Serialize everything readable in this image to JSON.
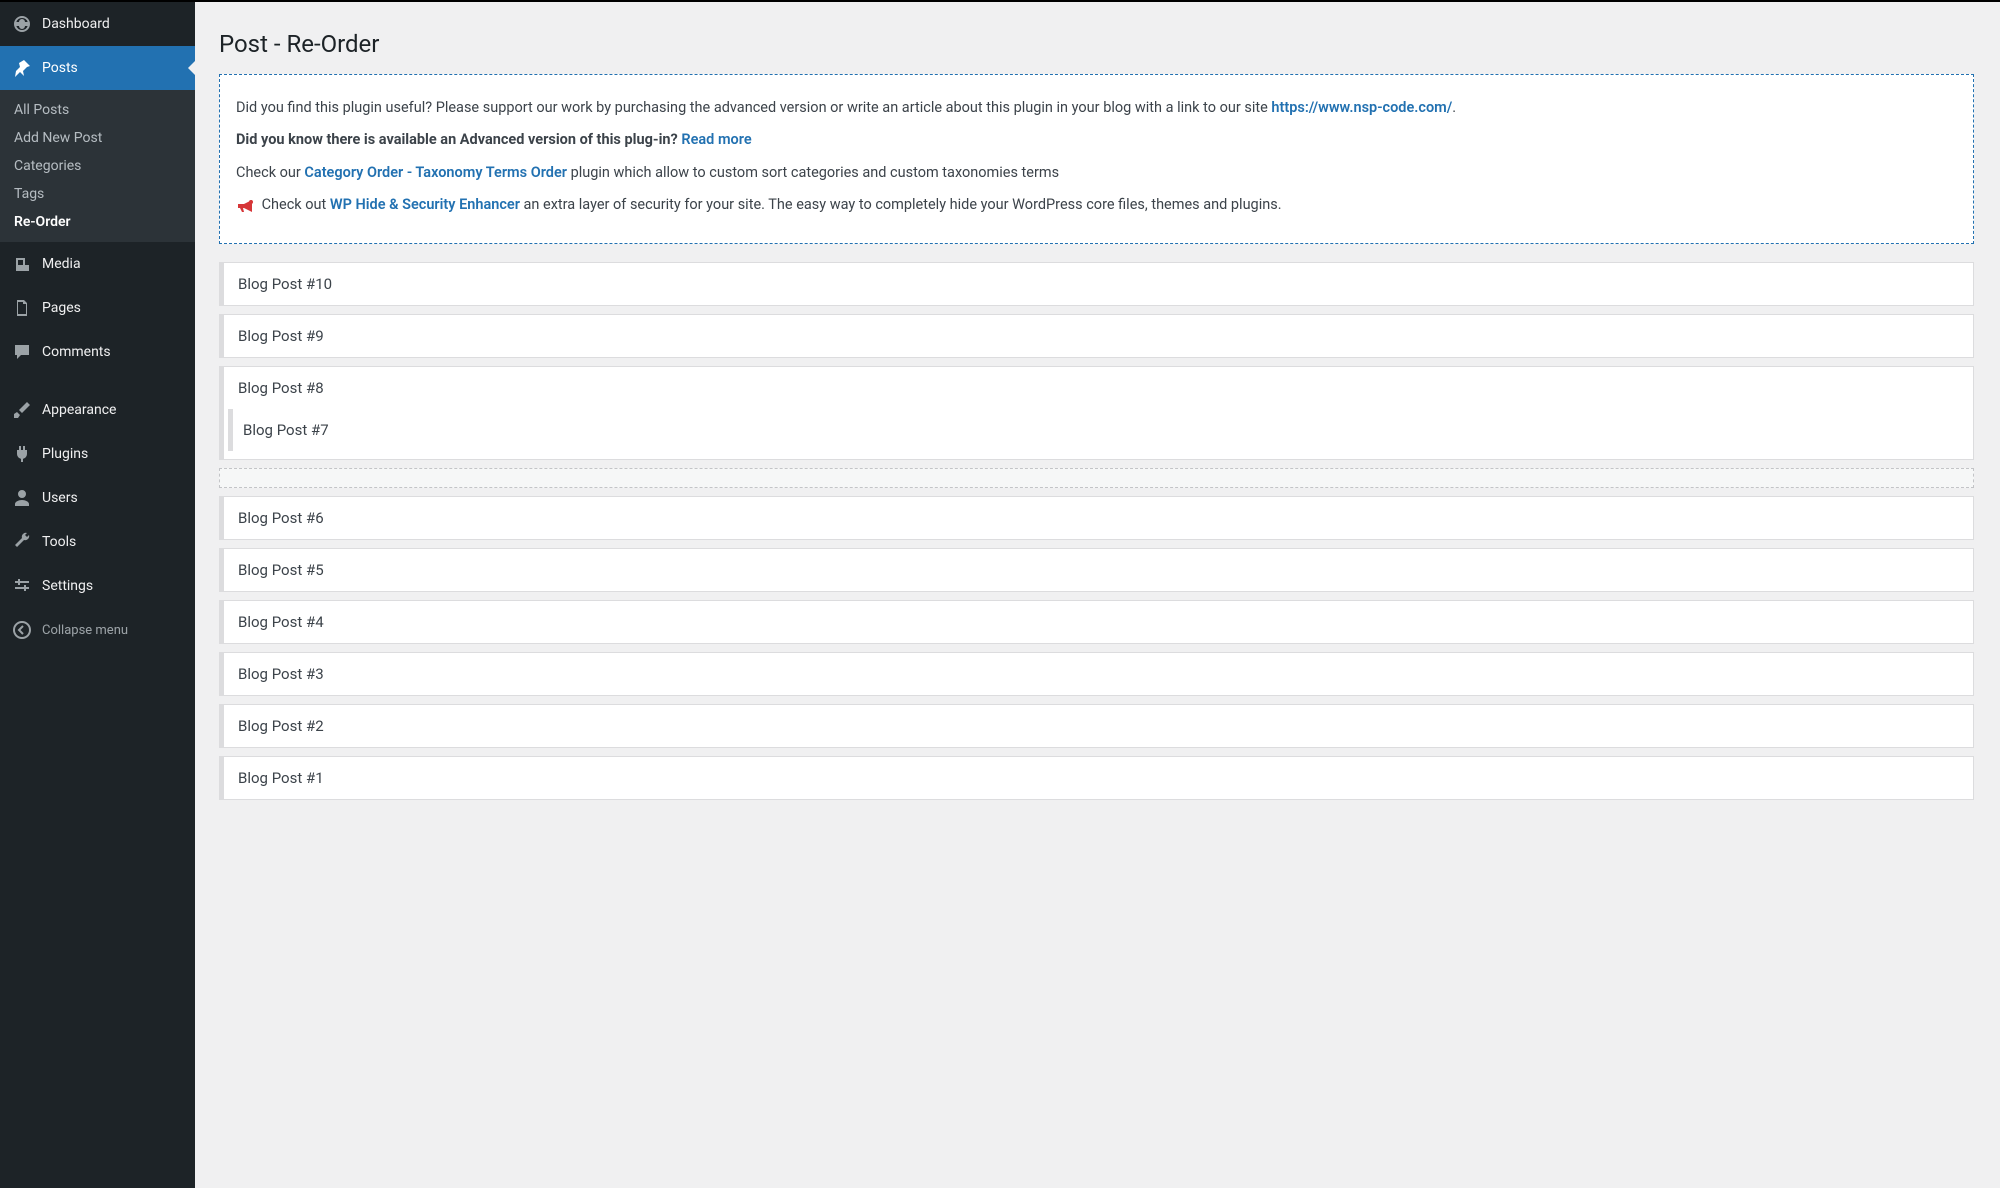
{
  "sidebar": {
    "dashboard": "Dashboard",
    "posts": "Posts",
    "posts_sub": {
      "all": "All Posts",
      "add": "Add New Post",
      "categories": "Categories",
      "tags": "Tags",
      "reorder": "Re-Order"
    },
    "media": "Media",
    "pages": "Pages",
    "comments": "Comments",
    "appearance": "Appearance",
    "plugins": "Plugins",
    "users": "Users",
    "tools": "Tools",
    "settings": "Settings",
    "collapse": "Collapse menu"
  },
  "page": {
    "title": "Post - Re-Order"
  },
  "notice": {
    "p1_a": "Did you find this plugin useful? Please support our work by purchasing the advanced version or write an article about this plugin in your blog with a link to our site ",
    "p1_link": "https://www.nsp-code.com/",
    "p1_b": ".",
    "p2_a": "Did you know there is available an Advanced version of this plug-in? ",
    "p2_link": "Read more",
    "p3_a": "Check our ",
    "p3_link": "Category Order - Taxonomy Terms Order",
    "p3_b": " plugin which allow to custom sort categories and custom taxonomies terms",
    "p4_a": " Check out ",
    "p4_link": "WP Hide & Security Enhancer",
    "p4_b": " an extra layer of security for your site. The easy way to completely hide your WordPress core files, themes and plugins."
  },
  "posts": [
    "Blog Post #10",
    "Blog Post #9",
    "Blog Post #8",
    "Blog Post #7",
    "Blog Post #6",
    "Blog Post #5",
    "Blog Post #4",
    "Blog Post #3",
    "Blog Post #2",
    "Blog Post #1"
  ]
}
